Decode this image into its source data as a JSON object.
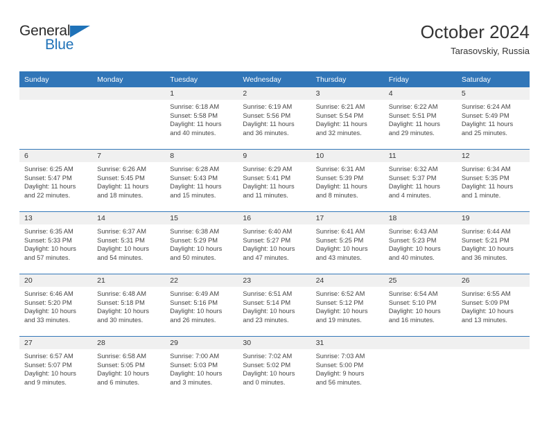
{
  "brand": {
    "name_top": "General",
    "name_bottom": "Blue",
    "accent_color": "#1f72b8"
  },
  "header": {
    "title": "October 2024",
    "location": "Tarasovskiy, Russia"
  },
  "theme": {
    "header_blue": "#3176b8",
    "daynum_strip": "#f0f0f0",
    "text": "#333333"
  },
  "calendar": {
    "weekday_headers": [
      "Sunday",
      "Monday",
      "Tuesday",
      "Wednesday",
      "Thursday",
      "Friday",
      "Saturday"
    ],
    "weeks": [
      [
        {
          "day": "",
          "lines": []
        },
        {
          "day": "",
          "lines": []
        },
        {
          "day": "1",
          "lines": [
            "Sunrise: 6:18 AM",
            "Sunset: 5:58 PM",
            "Daylight: 11 hours",
            "and 40 minutes."
          ]
        },
        {
          "day": "2",
          "lines": [
            "Sunrise: 6:19 AM",
            "Sunset: 5:56 PM",
            "Daylight: 11 hours",
            "and 36 minutes."
          ]
        },
        {
          "day": "3",
          "lines": [
            "Sunrise: 6:21 AM",
            "Sunset: 5:54 PM",
            "Daylight: 11 hours",
            "and 32 minutes."
          ]
        },
        {
          "day": "4",
          "lines": [
            "Sunrise: 6:22 AM",
            "Sunset: 5:51 PM",
            "Daylight: 11 hours",
            "and 29 minutes."
          ]
        },
        {
          "day": "5",
          "lines": [
            "Sunrise: 6:24 AM",
            "Sunset: 5:49 PM",
            "Daylight: 11 hours",
            "and 25 minutes."
          ]
        }
      ],
      [
        {
          "day": "6",
          "lines": [
            "Sunrise: 6:25 AM",
            "Sunset: 5:47 PM",
            "Daylight: 11 hours",
            "and 22 minutes."
          ]
        },
        {
          "day": "7",
          "lines": [
            "Sunrise: 6:26 AM",
            "Sunset: 5:45 PM",
            "Daylight: 11 hours",
            "and 18 minutes."
          ]
        },
        {
          "day": "8",
          "lines": [
            "Sunrise: 6:28 AM",
            "Sunset: 5:43 PM",
            "Daylight: 11 hours",
            "and 15 minutes."
          ]
        },
        {
          "day": "9",
          "lines": [
            "Sunrise: 6:29 AM",
            "Sunset: 5:41 PM",
            "Daylight: 11 hours",
            "and 11 minutes."
          ]
        },
        {
          "day": "10",
          "lines": [
            "Sunrise: 6:31 AM",
            "Sunset: 5:39 PM",
            "Daylight: 11 hours",
            "and 8 minutes."
          ]
        },
        {
          "day": "11",
          "lines": [
            "Sunrise: 6:32 AM",
            "Sunset: 5:37 PM",
            "Daylight: 11 hours",
            "and 4 minutes."
          ]
        },
        {
          "day": "12",
          "lines": [
            "Sunrise: 6:34 AM",
            "Sunset: 5:35 PM",
            "Daylight: 11 hours",
            "and 1 minute."
          ]
        }
      ],
      [
        {
          "day": "13",
          "lines": [
            "Sunrise: 6:35 AM",
            "Sunset: 5:33 PM",
            "Daylight: 10 hours",
            "and 57 minutes."
          ]
        },
        {
          "day": "14",
          "lines": [
            "Sunrise: 6:37 AM",
            "Sunset: 5:31 PM",
            "Daylight: 10 hours",
            "and 54 minutes."
          ]
        },
        {
          "day": "15",
          "lines": [
            "Sunrise: 6:38 AM",
            "Sunset: 5:29 PM",
            "Daylight: 10 hours",
            "and 50 minutes."
          ]
        },
        {
          "day": "16",
          "lines": [
            "Sunrise: 6:40 AM",
            "Sunset: 5:27 PM",
            "Daylight: 10 hours",
            "and 47 minutes."
          ]
        },
        {
          "day": "17",
          "lines": [
            "Sunrise: 6:41 AM",
            "Sunset: 5:25 PM",
            "Daylight: 10 hours",
            "and 43 minutes."
          ]
        },
        {
          "day": "18",
          "lines": [
            "Sunrise: 6:43 AM",
            "Sunset: 5:23 PM",
            "Daylight: 10 hours",
            "and 40 minutes."
          ]
        },
        {
          "day": "19",
          "lines": [
            "Sunrise: 6:44 AM",
            "Sunset: 5:21 PM",
            "Daylight: 10 hours",
            "and 36 minutes."
          ]
        }
      ],
      [
        {
          "day": "20",
          "lines": [
            "Sunrise: 6:46 AM",
            "Sunset: 5:20 PM",
            "Daylight: 10 hours",
            "and 33 minutes."
          ]
        },
        {
          "day": "21",
          "lines": [
            "Sunrise: 6:48 AM",
            "Sunset: 5:18 PM",
            "Daylight: 10 hours",
            "and 30 minutes."
          ]
        },
        {
          "day": "22",
          "lines": [
            "Sunrise: 6:49 AM",
            "Sunset: 5:16 PM",
            "Daylight: 10 hours",
            "and 26 minutes."
          ]
        },
        {
          "day": "23",
          "lines": [
            "Sunrise: 6:51 AM",
            "Sunset: 5:14 PM",
            "Daylight: 10 hours",
            "and 23 minutes."
          ]
        },
        {
          "day": "24",
          "lines": [
            "Sunrise: 6:52 AM",
            "Sunset: 5:12 PM",
            "Daylight: 10 hours",
            "and 19 minutes."
          ]
        },
        {
          "day": "25",
          "lines": [
            "Sunrise: 6:54 AM",
            "Sunset: 5:10 PM",
            "Daylight: 10 hours",
            "and 16 minutes."
          ]
        },
        {
          "day": "26",
          "lines": [
            "Sunrise: 6:55 AM",
            "Sunset: 5:09 PM",
            "Daylight: 10 hours",
            "and 13 minutes."
          ]
        }
      ],
      [
        {
          "day": "27",
          "lines": [
            "Sunrise: 6:57 AM",
            "Sunset: 5:07 PM",
            "Daylight: 10 hours",
            "and 9 minutes."
          ]
        },
        {
          "day": "28",
          "lines": [
            "Sunrise: 6:58 AM",
            "Sunset: 5:05 PM",
            "Daylight: 10 hours",
            "and 6 minutes."
          ]
        },
        {
          "day": "29",
          "lines": [
            "Sunrise: 7:00 AM",
            "Sunset: 5:03 PM",
            "Daylight: 10 hours",
            "and 3 minutes."
          ]
        },
        {
          "day": "30",
          "lines": [
            "Sunrise: 7:02 AM",
            "Sunset: 5:02 PM",
            "Daylight: 10 hours",
            "and 0 minutes."
          ]
        },
        {
          "day": "31",
          "lines": [
            "Sunrise: 7:03 AM",
            "Sunset: 5:00 PM",
            "Daylight: 9 hours",
            "and 56 minutes."
          ]
        },
        {
          "day": "",
          "lines": []
        },
        {
          "day": "",
          "lines": []
        }
      ]
    ]
  }
}
